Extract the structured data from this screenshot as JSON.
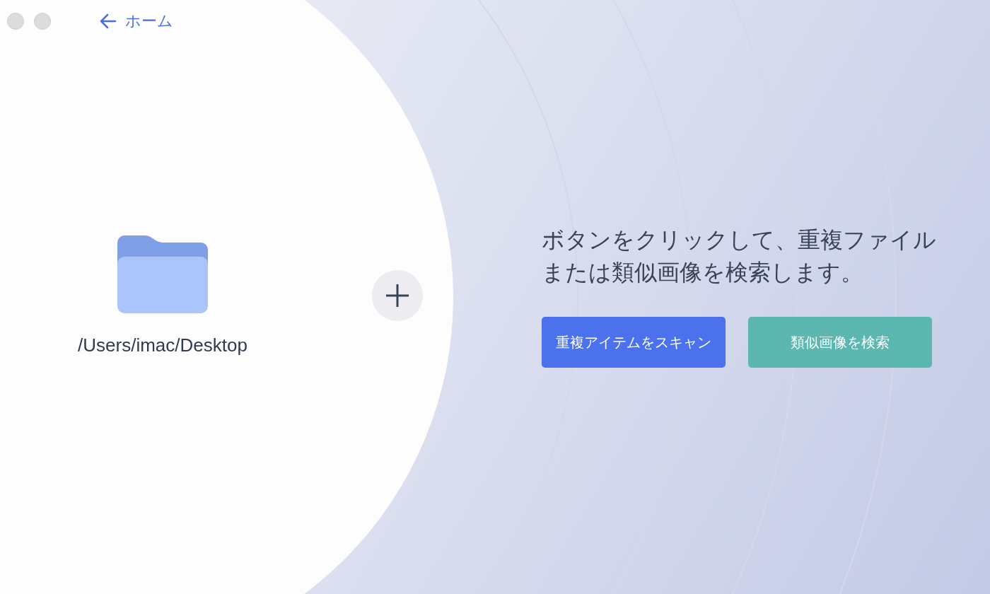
{
  "nav": {
    "back_label": "ホーム"
  },
  "source": {
    "path": "/Users/imac/Desktop"
  },
  "prompt": "ボタンをクリックして、重複ファイルまたは類似画像を検索します。",
  "buttons": [
    {
      "label": "重複アイテムをスキャン",
      "kind": "primary"
    },
    {
      "label": "類似画像を検索",
      "kind": "secondary"
    }
  ]
}
